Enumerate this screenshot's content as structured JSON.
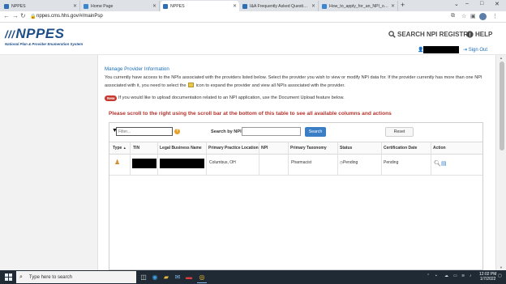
{
  "browser": {
    "tabs": [
      {
        "title": "NPPES",
        "favicon_color": "#2e6fb5",
        "active": false
      },
      {
        "title": "Home Page",
        "favicon_color": "#3a86d0",
        "active": false
      },
      {
        "title": "NPPES",
        "favicon_color": "#2e6fb5",
        "active": true
      },
      {
        "title": "I&A Frequently Asked Questions",
        "favicon_color": "#2e6fb5",
        "active": false
      },
      {
        "title": "How_to_apply_for_an_NPI_online",
        "favicon_color": "#3a86d0",
        "active": false
      }
    ],
    "new_tab": "+",
    "url": "nppes.cms.hhs.gov/#/mainPsp"
  },
  "header": {
    "logo": "NPPES",
    "logo_sub": "National Plan & Provider Enumeration System",
    "search_registry": "SEARCH NPI REGISTRY",
    "help": "HELP",
    "sign_out": "Sign Out"
  },
  "main": {
    "section_title": "Manage Provider Information",
    "intro_before_icon": "You currently have access to the NPIs associated with the providers listed below. Select the provider you wish to view or modify NPI data for. If the provider currently has more than one NPI associated with it, you need to select the",
    "intro_after_icon": "icon to expand the provider and view all NPIs associated with the provider.",
    "new_badge": "New",
    "new_text": "If you would like to upload documentation related to an NPI application, use the Document Upload feature below.",
    "scroll_warning": "Please scroll to the right using the scroll bar at the bottom of this table to see all available columns and actions"
  },
  "table": {
    "filter_placeholder": "Filter...",
    "search_by_npi_label": "Search by NPI:",
    "search_button": "Search",
    "reset_button": "Reset",
    "columns": [
      "Type",
      "TIN",
      "Legal Business Name",
      "Primary Practice Location",
      "NPI",
      "Primary Taxonomy",
      "Status",
      "Certification Date",
      "Action"
    ],
    "sort_indicator": "▲",
    "rows": [
      {
        "practice_location": "Columbus, OH",
        "npi": "",
        "taxonomy": "Pharmacist",
        "status": "Pending",
        "certification_date": "Pending"
      }
    ]
  },
  "taskbar": {
    "search_placeholder": "Type here to search",
    "time": "12:02 PM",
    "date": "1/7/2022"
  },
  "icons": {
    "lock": "lock-icon",
    "search": "search-icon",
    "help": "help-icon",
    "user": "user-icon",
    "signout": "signout-icon"
  }
}
